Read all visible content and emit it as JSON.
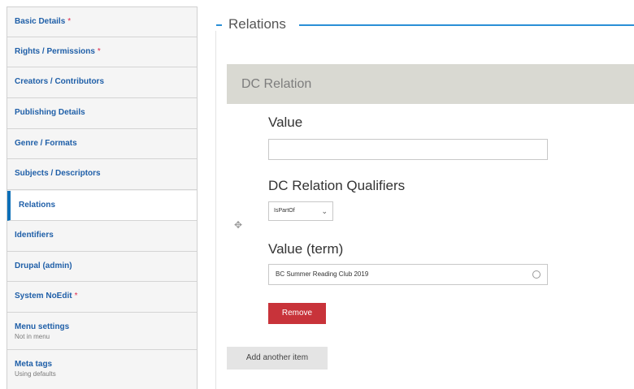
{
  "sidebar": {
    "tabs": [
      {
        "label": "Basic Details",
        "required": "*"
      },
      {
        "label": "Rights / Permissions",
        "required": "*"
      },
      {
        "label": "Creators / Contributors"
      },
      {
        "label": "Publishing Details"
      },
      {
        "label": "Genre / Formats"
      },
      {
        "label": "Subjects / Descriptors"
      },
      {
        "label": "Relations",
        "active": true
      },
      {
        "label": "Identifiers"
      },
      {
        "label": "Drupal (admin)"
      },
      {
        "label": "System NoEdit",
        "required": "*"
      },
      {
        "label": "Menu settings",
        "summary": "Not in menu"
      },
      {
        "label": "Meta tags",
        "summary": "Using defaults"
      }
    ]
  },
  "fieldset": {
    "legend": "Relations"
  },
  "dc_relation": {
    "header": "DC Relation",
    "value_label": "Value",
    "value": "",
    "qualifiers_label": "DC Relation Qualifiers",
    "qualifier_selected": "IsPartOf",
    "term_label": "Value (term)",
    "term_value": "BC Summer Reading Club 2019",
    "remove_label": "Remove"
  },
  "add_another_label": "Add another item",
  "colors": {
    "accent": "#2a8fd6",
    "link": "#1f5fa8",
    "required": "#e0284a",
    "danger": "#c8333a",
    "active_tab_border": "#0b6fb8"
  },
  "icons": {
    "drag": "move-handle-icon",
    "select": "chevron-down-icon",
    "autocomplete": "autocomplete-throbber-icon"
  }
}
